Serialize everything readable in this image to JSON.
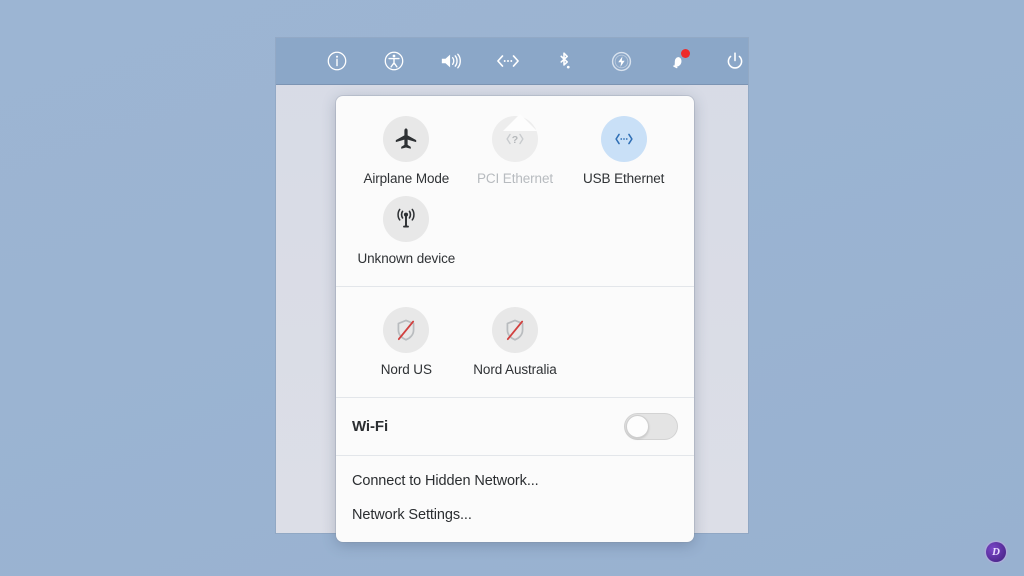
{
  "menubar": {
    "icons": [
      {
        "name": "info-icon",
        "label": "Info"
      },
      {
        "name": "accessibility-icon",
        "label": "Accessibility"
      },
      {
        "name": "volume-icon",
        "label": "Volume"
      },
      {
        "name": "network-icon",
        "label": "Network"
      },
      {
        "name": "bluetooth-icon",
        "label": "Bluetooth"
      },
      {
        "name": "battery-charging-icon",
        "label": "Power / Battery"
      },
      {
        "name": "notifications-bell-icon",
        "label": "Notifications"
      },
      {
        "name": "power-icon",
        "label": "Power"
      }
    ],
    "notification_badge": true
  },
  "panel": {
    "devices": [
      {
        "label": "Airplane Mode",
        "icon": "airplane-icon",
        "state": "normal"
      },
      {
        "label": "PCI Ethernet",
        "icon": "unknown-question-icon",
        "state": "disabled"
      },
      {
        "label": "USB Ethernet",
        "icon": "ethernet-icon",
        "state": "active"
      },
      {
        "label": "Unknown device",
        "icon": "broadcast-tower-icon",
        "state": "normal"
      }
    ],
    "vpns": [
      {
        "label": "Nord US",
        "icon": "shield-disabled-icon",
        "state": "normal"
      },
      {
        "label": "Nord Australia",
        "icon": "shield-disabled-icon",
        "state": "normal"
      }
    ],
    "wifi": {
      "label": "Wi-Fi",
      "enabled": false,
      "toggle_state": "off"
    },
    "menu_items": [
      {
        "label": "Connect to Hidden Network..."
      },
      {
        "label": "Network Settings..."
      }
    ]
  },
  "watermark": {
    "text": "D"
  },
  "colors": {
    "menubar_bg": "#8ba7c8",
    "panel_bg": "#fbfbfb",
    "desktop_bg": "#9ab4d2",
    "screen_bg": "#d9dce6",
    "active_tile": "#c9e0f7",
    "active_glyph": "#2f6fb5",
    "disabled_text": "#b7bbbf",
    "vpn_slash": "#d1403f",
    "notification_dot": "#ee2b2b"
  }
}
